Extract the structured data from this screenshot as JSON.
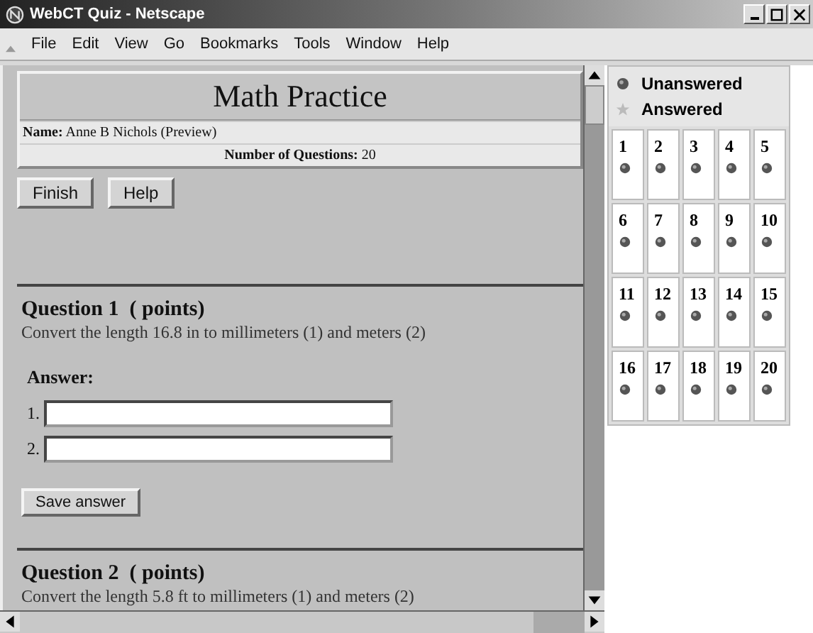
{
  "window": {
    "title": "WebCT Quiz - Netscape"
  },
  "menu": [
    "File",
    "Edit",
    "View",
    "Go",
    "Bookmarks",
    "Tools",
    "Window",
    "Help"
  ],
  "quiz": {
    "title": "Math Practice",
    "name_label": "Name:",
    "name": "Anne B Nichols (Preview)",
    "count_label": "Number of Questions:",
    "count": "20"
  },
  "buttons": [
    "Finish",
    "Help"
  ],
  "questions": [
    {
      "title": "Question 1  ( points)",
      "text": "Convert the length 16.8 in to millimeters (1) and meters (2)",
      "answer_label": "Answer:",
      "fields": [
        {
          "label": "1."
        },
        {
          "label": "2."
        }
      ],
      "save": "Save answer"
    },
    {
      "title": "Question 2  ( points)",
      "text": "Convert the length 5.8 ft to millimeters (1) and meters (2)"
    }
  ],
  "legend": [
    {
      "kind": "unanswered",
      "label": "Unanswered"
    },
    {
      "kind": "answered",
      "label": "Answered"
    }
  ],
  "grid": [
    {
      "number": "1",
      "answered": false
    },
    {
      "number": "2",
      "answered": false
    },
    {
      "number": "3",
      "answered": false
    },
    {
      "number": "4",
      "answered": false
    },
    {
      "number": "5",
      "answered": false
    },
    {
      "number": "6",
      "answered": false
    },
    {
      "number": "7",
      "answered": false
    },
    {
      "number": "8",
      "answered": false
    },
    {
      "number": "9",
      "answered": false
    },
    {
      "number": "10",
      "answered": false
    },
    {
      "number": "11",
      "answered": false
    },
    {
      "number": "12",
      "answered": false
    },
    {
      "number": "13",
      "answered": false
    },
    {
      "number": "14",
      "answered": false
    },
    {
      "number": "15",
      "answered": false
    },
    {
      "number": "16",
      "answered": false
    },
    {
      "number": "17",
      "answered": false
    },
    {
      "number": "18",
      "answered": false
    },
    {
      "number": "19",
      "answered": false
    },
    {
      "number": "20",
      "answered": false
    }
  ]
}
